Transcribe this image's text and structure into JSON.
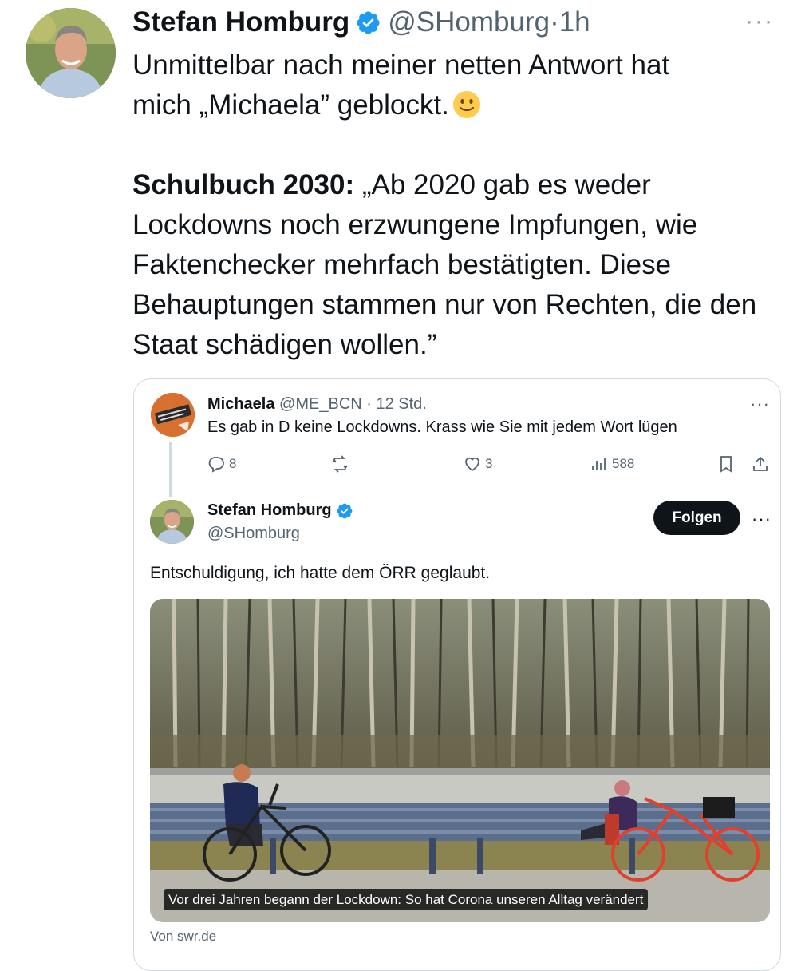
{
  "tweet": {
    "author_name": "Stefan Homburg",
    "handle": "@SHomburg",
    "time_sep": "·",
    "time": "1h",
    "more_label": "···",
    "line1": "Unmittelbar nach meiner netten Antwort hat",
    "line2": "mich „Michaela” geblockt.",
    "bold_lead": "Schulbuch 2030:",
    "body": " „Ab 2020 gab es weder Lockdowns noch erzwungene Impfungen, wie Faktenchecker mehrfach bestätigten. Diese Behauptungen stammen nur von Rechten, die den Staat schädigen wollen.”"
  },
  "quoted": {
    "author_name": "Michaela",
    "handle": "@ME_BCN",
    "time": "· 12 Std.",
    "more_label": "···",
    "text": "Es gab in D keine Lockdowns. Krass wie Sie mit jedem Wort lügen",
    "actions": {
      "replies": "8",
      "likes": "3",
      "views": "588"
    }
  },
  "reply": {
    "author_name": "Stefan Homburg",
    "handle": "@SHomburg",
    "follow_label": "Folgen",
    "more_label": "···",
    "text": "Entschuldigung, ich hatte dem ÖRR geglaubt.",
    "media_caption": "Vor drei Jahren begann der Lockdown: So hat Corona unseren Alltag verändert",
    "source": "Von swr.de"
  },
  "colors": {
    "text": "#0f1419",
    "secondary": "#536471",
    "verified": "#1d9bf0",
    "border": "#cfd9de"
  }
}
